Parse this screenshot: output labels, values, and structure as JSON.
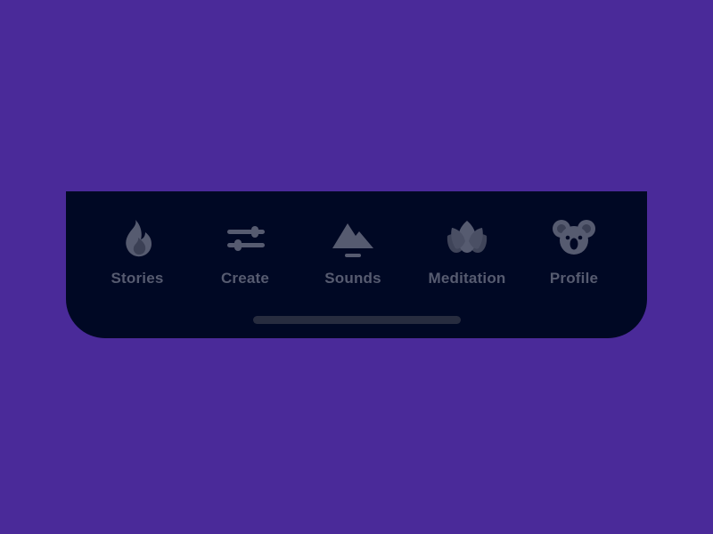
{
  "colors": {
    "background": "#4a2a99",
    "panel": "#000824",
    "inactive_icon": "#565b70",
    "home_indicator": "#272c3f"
  },
  "tabbar": {
    "tabs": [
      {
        "id": "stories",
        "label": "Stories",
        "icon": "flame-icon"
      },
      {
        "id": "create",
        "label": "Create",
        "icon": "sliders-icon"
      },
      {
        "id": "sounds",
        "label": "Sounds",
        "icon": "mountain-icon"
      },
      {
        "id": "meditation",
        "label": "Meditation",
        "icon": "lotus-icon"
      },
      {
        "id": "profile",
        "label": "Profile",
        "icon": "koala-icon"
      }
    ]
  }
}
